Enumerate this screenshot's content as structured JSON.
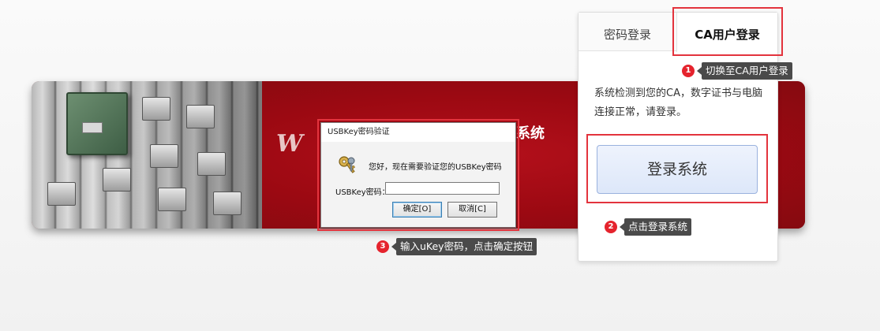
{
  "tabs": {
    "password_login": "密码登录",
    "ca_login": "CA用户登录"
  },
  "panel": {
    "message": "系统检测到您的CA，数字证书与电脑连接正常，请登录。",
    "login_button": "登录系统"
  },
  "banner": {
    "welcome_partial": "W",
    "system_title_partial": "系统"
  },
  "dialog": {
    "title": "USBKey密码验证",
    "prompt": "您好，现在需要验证您的USBKey密码",
    "password_label": "USBKey密码：",
    "password_value": "",
    "ok_button": "确定[O]",
    "cancel_button": "取消[C]"
  },
  "callouts": [
    {
      "number": "1",
      "text": "切换至CA用户登录"
    },
    {
      "number": "2",
      "text": "点击登录系统"
    },
    {
      "number": "3",
      "text": "输入uKey密码，点击确定按钮"
    }
  ],
  "colors": {
    "highlight": "#e3333d",
    "banner_red": "#9c0912",
    "step_badge": "#e5232d",
    "callout_bg": "#4a4a4a",
    "button_bg": "#e6edfb"
  }
}
